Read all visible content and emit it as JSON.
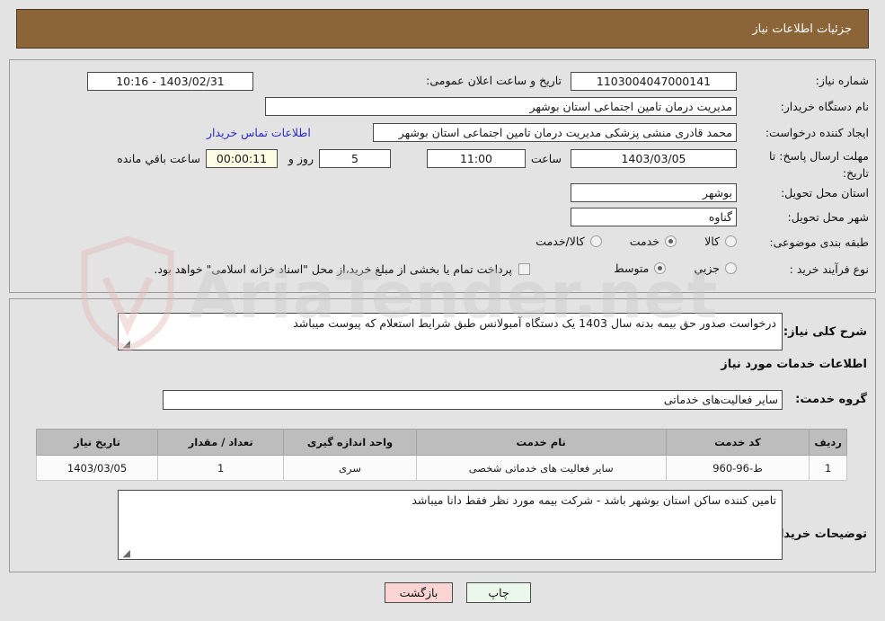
{
  "header": {
    "title": "جزئیات اطلاعات نیاز"
  },
  "form": {
    "need_number": {
      "label": "شماره نیاز:",
      "value": "1103004047000141"
    },
    "announce_datetime": {
      "label": "تاریخ و ساعت اعلان عمومی:",
      "value": "1403/02/31 - 10:16"
    },
    "buyer_org": {
      "label": "نام دستگاه خریدار:",
      "value": "مدیریت درمان تامین اجتماعی استان بوشهر"
    },
    "request_creator": {
      "label": "ایجاد کننده درخواست:",
      "value": "محمد قادری منشی پزشکی مدیریت درمان تامین اجتماعی استان بوشهر"
    },
    "contact_link": {
      "label": "اطلاعات تماس خریدار"
    },
    "deadline": {
      "label": "مهلت ارسال پاسخ: تا تاریخ:",
      "date": "1403/03/05",
      "hour_label": "ساعت",
      "hour": "11:00",
      "days": "5",
      "days_label": "روز و",
      "countdown": "00:00:11",
      "countdown_label": "ساعت باقي مانده"
    },
    "delivery_province": {
      "label": "استان محل تحویل:",
      "value": "بوشهر"
    },
    "delivery_city": {
      "label": "شهر محل تحویل:",
      "value": "گناوه"
    },
    "subject_category": {
      "label": "طبقه بندی موضوعی:",
      "options": [
        {
          "label": "کالا",
          "selected": false
        },
        {
          "label": "خدمت",
          "selected": true
        },
        {
          "label": "کالا/خدمت",
          "selected": false
        }
      ]
    },
    "purchase_type": {
      "label": "نوع فرآیند خرید :",
      "options": [
        {
          "label": "جزیي",
          "selected": false
        },
        {
          "label": "متوسط",
          "selected": true
        }
      ],
      "treasury_checkbox": {
        "checked": false,
        "label": "پرداخت تمام یا بخشی از مبلغ خرید،از محل \"اسناد خزانه اسلامی\" خواهد بود."
      }
    }
  },
  "need_summary": {
    "label": "شرح کلی نیاز:",
    "value": "درخواست صدور حق بیمه بدنه سال 1403 یک دستگاه آمبولانس طبق شرایط استعلام که پیوست میباشد"
  },
  "services": {
    "section_title": "اطلاعات خدمات مورد نیاز",
    "service_group": {
      "label": "گروه خدمت:",
      "value": "سایر فعالیت‌های خدماتی"
    },
    "table": {
      "columns": [
        "ردیف",
        "کد خدمت",
        "نام خدمت",
        "واحد اندازه گیری",
        "تعداد / مقدار",
        "تاریخ نیاز"
      ],
      "rows": [
        {
          "row_no": "1",
          "service_code": "ط-96-960",
          "service_name": "سایر فعالیت های خدماتی شخصی",
          "unit": "سری",
          "quantity": "1",
          "need_date": "1403/03/05"
        }
      ]
    }
  },
  "buyer_notes": {
    "label": "توضیحات خریدار:",
    "value": "تامین کننده ساکن استان بوشهر باشد - شرکت بیمه مورد نظر فقط دانا میباشد"
  },
  "footer": {
    "print_button": "چاپ",
    "back_button": "بازگشت"
  },
  "watermark": {
    "text": "AriaTender.net"
  },
  "colors": {
    "header_bg": "#8b6438",
    "page_bg": "#e3e3e3",
    "link": "#2b2bc8",
    "table_header_bg": "#bdbdbd",
    "back_button_bg": "#fbd4d4",
    "print_button_bg": "#eaf7ea",
    "countdown_bg": "#fdfce4"
  }
}
